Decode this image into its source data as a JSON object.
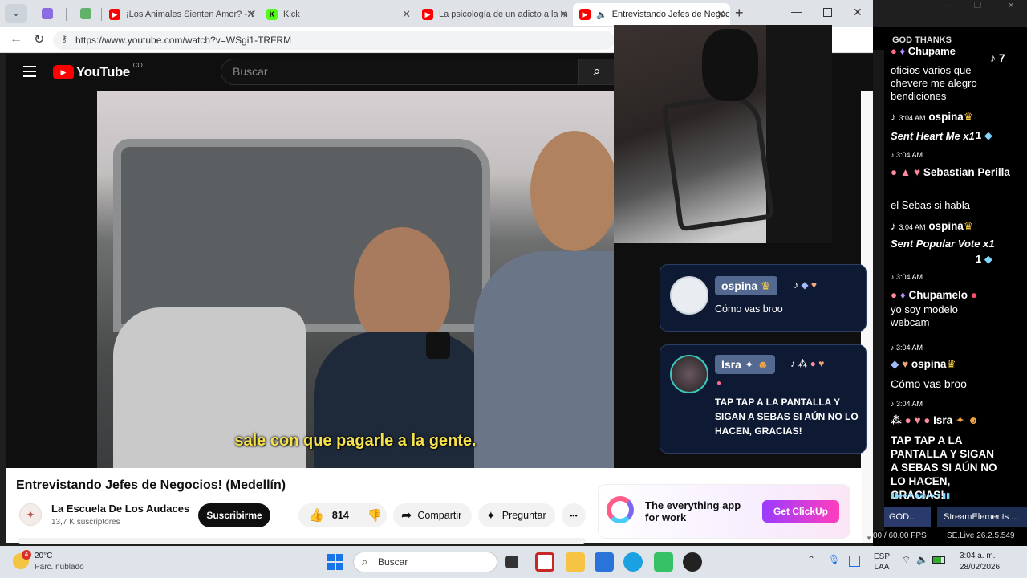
{
  "tabs": [
    {
      "label": "¡Los Animales Sienten Amor? - Y",
      "color": "#ff0000"
    },
    {
      "label": "Kick",
      "color": "#53fc18"
    },
    {
      "label": "La psicología de un adicto a la m",
      "color": "#ff0000"
    },
    {
      "label": "Entrevistando Jefes de Negoc",
      "color": "#ff0000"
    }
  ],
  "url": "https://www.youtube.com/watch?v=WSgi1-TRFRM",
  "yt": {
    "logo": "YouTube",
    "country": "CO",
    "search_placeholder": "Buscar"
  },
  "video": {
    "caption": "sale con que pagarle a la gente.",
    "title": "Entrevistando Jefes de Negocios! (Medellín)"
  },
  "channel": {
    "name": "La Escuela De Los Audaces",
    "subs": "13,7 K suscriptores",
    "subscribe": "Suscribirme"
  },
  "actions": {
    "likes": "814",
    "share": "Compartir",
    "ask": "Preguntar",
    "more": "•••"
  },
  "ad": {
    "text": "The everything app for work",
    "cta": "Get ClickUp"
  },
  "bubbles": [
    {
      "user": "ospina",
      "msg": "Cómo vas broo"
    },
    {
      "user": "Isra",
      "msg": "TAP TAP A LA PANTALLA Y SIGAN A SEBAS SI AÚN NO LO HACEN, GRACIAS!"
    }
  ],
  "chat": {
    "header": "GOD THANKS",
    "m1_user": "Chupame",
    "m1_count": "7",
    "m1_text": "oficios varios que chevere me alegro bendiciones",
    "m2_time": "3:04 AM",
    "m2_user": "ospina",
    "m2_text": "Sent Heart Me x1",
    "m2_count": "1",
    "m3_time": "3:04 AM",
    "m3_user": "Sebastian Perilla",
    "m3_text": "el Sebas si habla",
    "m4_time": "3:04 AM",
    "m4_user": "ospina",
    "m4_text": "Sent Popular Vote x1",
    "m4_count": "1",
    "m5_time": "3:04 AM",
    "m5_user": "Chupamelo",
    "m5_text": "yo soy modelo webcam",
    "m6_time": "3:04 AM",
    "m6_user": "ospina",
    "m6_text": "Cómo vas broo",
    "m7_time": "3:04 AM",
    "m7_user": "Isra",
    "m7_text": "TAP TAP A LA PANTALLA Y SIGAN A SEBAS SI AÚN NO LO HACEN, GRACIAS!",
    "tab1": "GOD...",
    "tab2": "StreamElements ...",
    "fps": "00 / 60.00 FPS",
    "selive": "SE.Live 26.2.5.549"
  },
  "taskbar": {
    "temp": "20°C",
    "weather": "Parc. nublado",
    "badge": "4",
    "search": "Buscar",
    "lang1": "ESP",
    "lang2": "LAA",
    "time": "3:04 a. m.",
    "date": "28/02/2026"
  }
}
